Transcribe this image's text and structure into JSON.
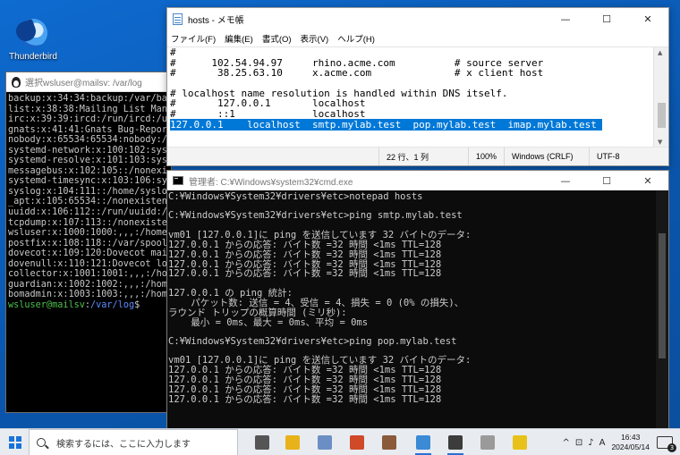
{
  "desktop": {
    "thunderbird_label": "Thunderbird"
  },
  "terminal": {
    "title": "選択wsluser@mailsv: /var/log",
    "lines": [
      "backup:x:34:34:backup:/var/bac",
      "list:x:38:38:Mailing List Mana",
      "irc:x:39:39:ircd:/run/ircd:/us",
      "gnats:x:41:41:Gnats Bug-Report",
      "nobody:x:65534:65534:nobody:/n",
      "systemd-network:x:100:102:syst",
      "systemd-resolve:x:101:103:syst",
      "messagebus:x:102:105::/nonexi",
      "systemd-timesync:x:103:106:sys",
      "syslog:x:104:111::/home/syslo",
      "_apt:x:105:65534::/nonexistent",
      "uuidd:x:106:112::/run/uuidd:/",
      "tcpdump:x:107:113::/nonexister",
      "wsluser:x:1000:1000:,,,:/home/",
      "postfix:x:108:118::/var/spool/",
      "dovecot:x:109:120:Dovecot mail",
      "dovenull:x:110:121:Dovecot log",
      "collector:x:1001:1001:,,,:/hom",
      "guardian:x:1002:1002:,,,:/home",
      "bomadmin:x:1003:1003:,,,:/home"
    ],
    "prompt_user": "wsluser@mailsv",
    "prompt_sep": ":",
    "prompt_dir": "/var/log",
    "prompt_end": "$"
  },
  "notepad": {
    "title": "hosts - メモ帳",
    "menu": [
      "ファイル(F)",
      "編集(E)",
      "書式(O)",
      "表示(V)",
      "ヘルプ(H)"
    ],
    "lines": [
      "#",
      "#      102.54.94.97     rhino.acme.com          # source server",
      "#       38.25.63.10     x.acme.com              # x client host",
      "",
      "# localhost name resolution is handled within DNS itself.",
      "#       127.0.0.1       localhost",
      "#       ::1             localhost"
    ],
    "selected_line": "127.0.0.1    localhost  smtp.mylab.test  pop.mylab.test  imap.mylab.test ",
    "status": {
      "position": "22 行、1 列",
      "zoom": "100%",
      "eol": "Windows (CRLF)",
      "encoding": "UTF-8"
    },
    "ctrl": {
      "min": "—",
      "max": "☐",
      "close": "✕"
    }
  },
  "cmd": {
    "title": "管理者: C:¥Windows¥system32¥cmd.exe",
    "lines": [
      "C:¥Windows¥System32¥drivers¥etc>notepad hosts",
      "",
      "C:¥Windows¥System32¥drivers¥etc>ping smtp.mylab.test",
      "",
      "vm01 [127.0.0.1]に ping を送信しています 32 バイトのデータ:",
      "127.0.0.1 からの応答: バイト数 =32 時間 <1ms TTL=128",
      "127.0.0.1 からの応答: バイト数 =32 時間 <1ms TTL=128",
      "127.0.0.1 からの応答: バイト数 =32 時間 <1ms TTL=128",
      "127.0.0.1 からの応答: バイト数 =32 時間 <1ms TTL=128",
      "",
      "127.0.0.1 の ping 統計:",
      "    パケット数: 送信 = 4、受信 = 4、損失 = 0 (0% の損失)、",
      "ラウンド トリップの概算時間 (ミリ秒):",
      "    最小 = 0ms、最大 = 0ms、平均 = 0ms",
      "",
      "C:¥Windows¥System32¥drivers¥etc>ping pop.mylab.test",
      "",
      "vm01 [127.0.0.1]に ping を送信しています 32 バイトのデータ:",
      "127.0.0.1 からの応答: バイト数 =32 時間 <1ms TTL=128",
      "127.0.0.1 からの応答: バイト数 =32 時間 <1ms TTL=128",
      "127.0.0.1 からの応答: バイト数 =32 時間 <1ms TTL=128",
      "127.0.0.1 からの応答: バイト数 =32 時間 <1ms TTL=128"
    ],
    "ctrl": {
      "min": "—",
      "max": "☐",
      "close": "✕"
    }
  },
  "taskbar": {
    "search_placeholder": "検索するには、ここに入力します",
    "tray": {
      "chevron": "^",
      "ime": "A",
      "time": "16:43",
      "date": "2024/05/14",
      "notifications": "3"
    },
    "apps": [
      {
        "name": "task-view",
        "color": "#555555"
      },
      {
        "name": "chrome",
        "color": "#e8b21a"
      },
      {
        "name": "mail-tool",
        "color": "#6b8fc4"
      },
      {
        "name": "setup",
        "color": "#d04a2a"
      },
      {
        "name": "package",
        "color": "#8a5a3a"
      },
      {
        "name": "notepad",
        "color": "#3a8ad6"
      },
      {
        "name": "terminal",
        "color": "#3c3c3c"
      },
      {
        "name": "doc",
        "color": "#9a9a9a"
      },
      {
        "name": "mail",
        "color": "#e8c21a"
      }
    ]
  }
}
